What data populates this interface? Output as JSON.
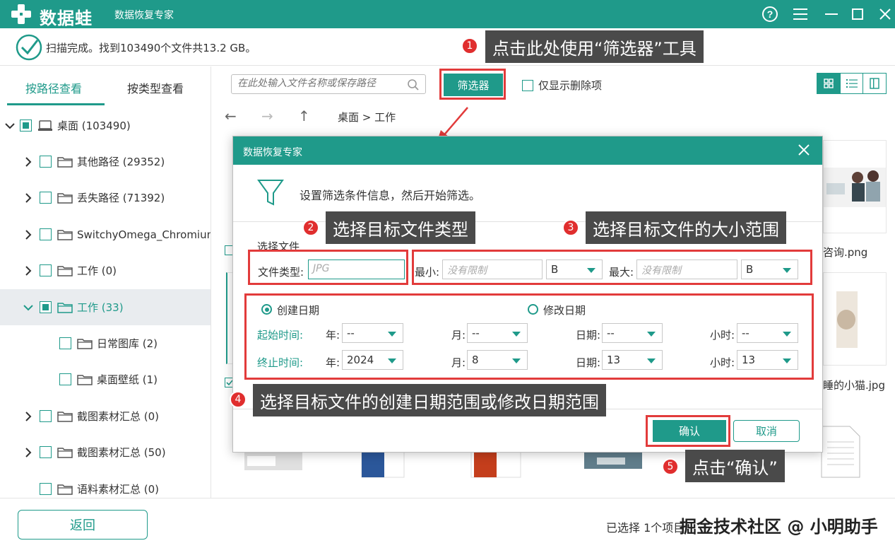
{
  "app": {
    "logo_text": "数据蛙",
    "subtitle": "数据恢复专家"
  },
  "window_controls": [
    "help-icon",
    "menu-icon",
    "minimize-icon",
    "maximize-icon",
    "close-icon"
  ],
  "status": {
    "text": "扫描完成。找到103490个文件共13.2 GB。"
  },
  "sidebar": {
    "tabs": [
      {
        "label": "按路径查看",
        "active": true
      },
      {
        "label": "按类型查看",
        "active": false
      }
    ],
    "tree": [
      {
        "label": "桌面 (103490)",
        "level": 0,
        "expanded": true,
        "checked": "partial",
        "icon": "drive-icon"
      },
      {
        "label": "其他路径 (29352)",
        "level": 1,
        "expanded": false,
        "checked": "none",
        "icon": "folder-icon"
      },
      {
        "label": "丢失路径 (71392)",
        "level": 1,
        "expanded": false,
        "checked": "none",
        "icon": "folder-icon"
      },
      {
        "label": "SwitchyOmega_Chromium",
        "level": 1,
        "expanded": false,
        "checked": "none",
        "icon": "folder-icon"
      },
      {
        "label": "工作 (0)",
        "level": 1,
        "expanded": false,
        "checked": "none",
        "icon": "folder-icon"
      },
      {
        "label": "工作 (33)",
        "level": 1,
        "expanded": true,
        "checked": "partial",
        "icon": "folder-icon",
        "selected": true
      },
      {
        "label": "日常图库 (2)",
        "level": 2,
        "expanded": null,
        "checked": "none",
        "icon": "folder-icon"
      },
      {
        "label": "桌面壁纸 (1)",
        "level": 2,
        "expanded": null,
        "checked": "none",
        "icon": "folder-icon"
      },
      {
        "label": "截图素材汇总 (0)",
        "level": 1,
        "expanded": false,
        "checked": "none",
        "icon": "folder-icon"
      },
      {
        "label": "截图素材汇总 (50)",
        "level": 1,
        "expanded": false,
        "checked": "none",
        "icon": "folder-icon"
      },
      {
        "label": "语料素材汇总 (0)",
        "level": 1,
        "expanded": null,
        "checked": "none",
        "icon": "folder-icon"
      }
    ]
  },
  "toolbar": {
    "search_placeholder": "在此处输入文件名称或保存路径",
    "filter_label": "筛选器",
    "only_deleted_label": "仅显示删除项"
  },
  "breadcrumb": "桌面 > 工作",
  "files": {
    "names": [
      "咨询.png",
      "睡的小猫.jpg"
    ]
  },
  "dialog": {
    "title": "数据恢复专家",
    "hint": "设置筛选条件信息，然后开始筛选。",
    "section_file": "选择文件",
    "file_type_label": "文件类型:",
    "file_type_placeholder": "JPG",
    "min_label": "最小:",
    "min_placeholder": "没有限制",
    "min_unit": "B",
    "max_label": "最大:",
    "max_placeholder": "没有限制",
    "max_unit": "B",
    "date_mode": {
      "created_label": "创建日期",
      "modified_label": "修改日期",
      "selected": "created"
    },
    "start_label": "起始时间:",
    "end_label": "终止时间:",
    "year_label": "年:",
    "month_label": "月:",
    "day_label": "日期:",
    "hour_label": "小时:",
    "start": {
      "year": "--",
      "month": "--",
      "day": "--",
      "hour": "--"
    },
    "end": {
      "year": "2024",
      "month": "8",
      "day": "13",
      "hour": "13"
    },
    "ok_label": "确认",
    "cancel_label": "取消"
  },
  "annotations": [
    {
      "num": "1",
      "text": "点击此处使用“筛选器”工具"
    },
    {
      "num": "2",
      "text": "选择目标文件类型"
    },
    {
      "num": "3",
      "text": "选择目标文件的大小范围"
    },
    {
      "num": "4",
      "text": "选择目标文件的创建日期范围或修改日期范围"
    },
    {
      "num": "5",
      "text": "点击“确认”"
    }
  ],
  "footer": {
    "back_label": "返回",
    "selected_text": "已选择 1个项目",
    "watermark": "掘金技术社区 @ 小明助手"
  },
  "colors": {
    "brand": "#1f9a8a",
    "annotation_red": "#e23b3b",
    "callout_bg": "#4a4a4a"
  }
}
